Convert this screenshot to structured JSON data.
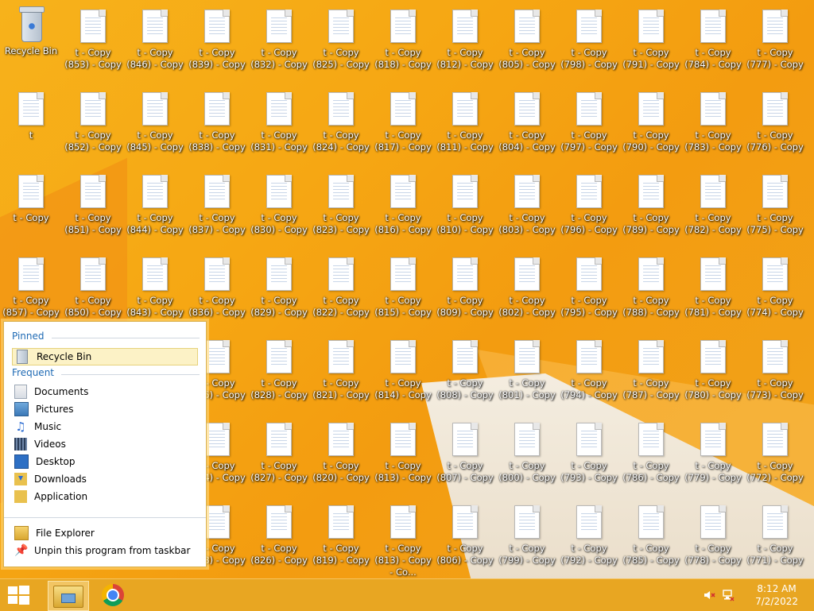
{
  "desktop": {
    "icons": [
      {
        "label": "Recycle Bin",
        "kind": "bin"
      },
      {
        "label": "t - Copy (853) - Copy"
      },
      {
        "label": "t - Copy (846) - Copy"
      },
      {
        "label": "t - Copy (839) - Copy"
      },
      {
        "label": "t - Copy (832) - Copy"
      },
      {
        "label": "t - Copy (825) - Copy"
      },
      {
        "label": "t - Copy (818) - Copy"
      },
      {
        "label": "t - Copy (812) - Copy"
      },
      {
        "label": "t - Copy (805) - Copy"
      },
      {
        "label": "t - Copy (798) - Copy"
      },
      {
        "label": "t - Copy (791) - Copy"
      },
      {
        "label": "t - Copy (784) - Copy"
      },
      {
        "label": "t - Copy (777) - Copy"
      },
      {
        "label": "t"
      },
      {
        "label": "t - Copy (852) - Copy"
      },
      {
        "label": "t - Copy (845) - Copy"
      },
      {
        "label": "t - Copy (838) - Copy"
      },
      {
        "label": "t - Copy (831) - Copy"
      },
      {
        "label": "t - Copy (824) - Copy"
      },
      {
        "label": "t - Copy (817) - Copy"
      },
      {
        "label": "t - Copy (811) - Copy"
      },
      {
        "label": "t - Copy (804) - Copy"
      },
      {
        "label": "t - Copy (797) - Copy"
      },
      {
        "label": "t - Copy (790) - Copy"
      },
      {
        "label": "t - Copy (783) - Copy"
      },
      {
        "label": "t - Copy (776) - Copy"
      },
      {
        "label": "t - Copy"
      },
      {
        "label": "t - Copy (851) - Copy"
      },
      {
        "label": "t - Copy (844) - Copy"
      },
      {
        "label": "t - Copy (837) - Copy"
      },
      {
        "label": "t - Copy (830) - Copy"
      },
      {
        "label": "t - Copy (823) - Copy"
      },
      {
        "label": "t - Copy (816) - Copy"
      },
      {
        "label": "t - Copy (810) - Copy"
      },
      {
        "label": "t - Copy (803) - Copy"
      },
      {
        "label": "t - Copy (796) - Copy"
      },
      {
        "label": "t - Copy (789) - Copy"
      },
      {
        "label": "t - Copy (782) - Copy"
      },
      {
        "label": "t - Copy (775) - Copy"
      },
      {
        "label": "t - Copy (857) - Copy"
      },
      {
        "label": "t - Copy (850) - Copy"
      },
      {
        "label": "t - Copy (843) - Copy"
      },
      {
        "label": "t - Copy (836) - Copy"
      },
      {
        "label": "t - Copy (829) - Copy"
      },
      {
        "label": "t - Copy (822) - Copy"
      },
      {
        "label": "t - Copy (815) - Copy"
      },
      {
        "label": "t - Copy (809) - Copy"
      },
      {
        "label": "t - Copy (802) - Copy"
      },
      {
        "label": "t - Copy (795) - Copy"
      },
      {
        "label": "t - Copy (788) - Copy"
      },
      {
        "label": "t - Copy (781) - Copy"
      },
      {
        "label": "t - Copy (774) - Copy"
      },
      {
        "label": "",
        "hidden": true
      },
      {
        "label": "",
        "hidden": true
      },
      {
        "label": "",
        "hidden": true
      },
      {
        "label": "t - Copy (835) - Copy"
      },
      {
        "label": "t - Copy (828) - Copy"
      },
      {
        "label": "t - Copy (821) - Copy"
      },
      {
        "label": "t - Copy (814) - Copy"
      },
      {
        "label": "t - Copy (808) - Copy"
      },
      {
        "label": "t - Copy (801) - Copy"
      },
      {
        "label": "t - Copy (794) - Copy"
      },
      {
        "label": "t - Copy (787) - Copy"
      },
      {
        "label": "t - Copy (780) - Copy"
      },
      {
        "label": "t - Copy (773) - Copy"
      },
      {
        "label": "",
        "hidden": true
      },
      {
        "label": "",
        "hidden": true
      },
      {
        "label": "",
        "hidden": true
      },
      {
        "label": "t - Copy (834) - Copy"
      },
      {
        "label": "t - Copy (827) - Copy"
      },
      {
        "label": "t - Copy (820) - Copy"
      },
      {
        "label": "t - Copy (813) - Copy"
      },
      {
        "label": "t - Copy (807) - Copy"
      },
      {
        "label": "t - Copy (800) - Copy"
      },
      {
        "label": "t - Copy (793) - Copy"
      },
      {
        "label": "t - Copy (786) - Copy"
      },
      {
        "label": "t - Copy (779) - Copy"
      },
      {
        "label": "t - Copy (772) - Copy"
      },
      {
        "label": "",
        "hidden": true
      },
      {
        "label": "",
        "hidden": true
      },
      {
        "label": "",
        "hidden": true
      },
      {
        "label": "t - Copy (833) - Copy"
      },
      {
        "label": "t - Copy (826) - Copy"
      },
      {
        "label": "t - Copy (819) - Copy"
      },
      {
        "label": "t - Copy (813) - Copy - Co..."
      },
      {
        "label": "t - Copy (806) - Copy"
      },
      {
        "label": "t - Copy (799) - Copy"
      },
      {
        "label": "t - Copy (792) - Copy"
      },
      {
        "label": "t - Copy (785) - Copy"
      },
      {
        "label": "t - Copy (778) - Copy"
      },
      {
        "label": "t - Copy (771) - Copy"
      }
    ]
  },
  "jumplist": {
    "pinned_header": "Pinned",
    "pinned": [
      {
        "label": "Recycle Bin",
        "icon": "recycle-bin-icon"
      }
    ],
    "frequent_header": "Frequent",
    "frequent": [
      {
        "label": "Documents",
        "icon": "documents-icon"
      },
      {
        "label": "Pictures",
        "icon": "pictures-icon"
      },
      {
        "label": "Music",
        "icon": "music-icon"
      },
      {
        "label": "Videos",
        "icon": "videos-icon"
      },
      {
        "label": "Desktop",
        "icon": "desktop-icon"
      },
      {
        "label": "Downloads",
        "icon": "downloads-icon"
      },
      {
        "label": "Application",
        "icon": "folder-icon"
      }
    ],
    "tasks": [
      {
        "label": "File Explorer",
        "icon": "file-explorer-icon"
      },
      {
        "label": "Unpin this program from taskbar",
        "icon": "unpin-icon"
      }
    ]
  },
  "taskbar": {
    "time": "8:12 AM",
    "date": "7/2/2022",
    "apps": [
      {
        "name": "File Explorer",
        "icon": "file-explorer-icon"
      },
      {
        "name": "Google Chrome",
        "icon": "chrome-icon"
      }
    ],
    "tray": [
      {
        "icon": "speaker-muted-icon"
      },
      {
        "icon": "network-icon"
      }
    ]
  }
}
